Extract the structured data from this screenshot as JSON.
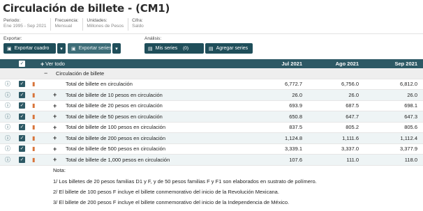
{
  "title": "Circulación de billete - (CM1)",
  "meta": [
    {
      "label": "Periodo:",
      "value": "Ene 1995 - Sep 2021"
    },
    {
      "label": "Frecuencia:",
      "value": "Mensual"
    },
    {
      "label": "Unidades:",
      "value": "Millones de Pesos"
    },
    {
      "label": "Cifra:",
      "value": "Saldo"
    }
  ],
  "toolbar": {
    "export_label": "Exportar:",
    "export_table": "Exportar cuadro",
    "export_series": "Exportar series",
    "analysis_label": "Análisis:",
    "my_series": "Mis series",
    "my_series_count": "(0)",
    "add_series": "Agregar series"
  },
  "table": {
    "view_all": "Ver todo",
    "columns": [
      "Jul 2021",
      "Ago 2021",
      "Sep 2021"
    ],
    "group": "Circulación de billete",
    "rows": [
      {
        "name": "Total de billete en circulación",
        "values": [
          "6,772.7",
          "6,756.0",
          "6,812.0"
        ]
      },
      {
        "name": "Total de billete de 10 pesos en circulación",
        "values": [
          "26.0",
          "26.0",
          "26.0"
        ]
      },
      {
        "name": "Total de billete de 20 pesos en circulación",
        "values": [
          "693.9",
          "687.5",
          "698.1"
        ]
      },
      {
        "name": "Total de billete de 50 pesos en circulación",
        "values": [
          "650.8",
          "647.7",
          "647.3"
        ]
      },
      {
        "name": "Total de billete de 100 pesos en circulación",
        "values": [
          "837.5",
          "805.2",
          "805.6"
        ]
      },
      {
        "name": "Total de billete de 200 pesos en circulación",
        "values": [
          "1,124.8",
          "1,111.6",
          "1,112.4"
        ]
      },
      {
        "name": "Total de billete de 500 pesos en circulación",
        "values": [
          "3,339.1",
          "3,337.0",
          "3,377.9"
        ]
      },
      {
        "name": "Total de billete de 1,000 pesos en circulación",
        "values": "107.6|111.0|118.0"
      }
    ]
  },
  "notes": {
    "title": "Nota:",
    "lines": [
      "1/ Los billetes de 20 pesos familias D1 y F, y de 50 pesos familias F y F1 son elaborados en sustrato de polímero.",
      "2/ El billete de 100 pesos F incluye el billete conmemorativo del inicio de la Revolución Mexicana.",
      "3/ El billete de 200 pesos F incluye el billete conmemorativo del inicio de la Independencia de México."
    ]
  },
  "colors": {
    "header": "#2d5965",
    "button": "#1f4e5a",
    "alt_row": "#eef4f5",
    "chart_icon": "#d8743a"
  },
  "icons": {
    "info": "info-icon",
    "check": "checkbox-icon",
    "chart": "chart-icon",
    "plus": "plus-icon"
  }
}
